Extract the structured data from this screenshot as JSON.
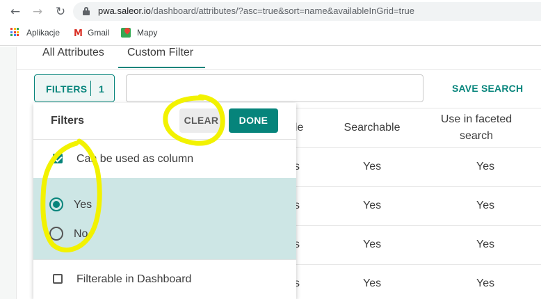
{
  "browser": {
    "url_domain": "pwa.saleor.io",
    "url_path": "/dashboard/attributes/?asc=true&sort=name&availableInGrid=true",
    "bookmarks": [
      {
        "label": "Aplikacje",
        "icon": "apps-grid-icon"
      },
      {
        "label": "Gmail",
        "icon": "gmail-icon"
      },
      {
        "label": "Mapy",
        "icon": "maps-icon"
      }
    ]
  },
  "tabs": [
    "All Attributes",
    "Custom Filter"
  ],
  "toolbar": {
    "filters_label": "FILTERS",
    "filters_count": "1",
    "search_value": "",
    "save_search_label": "SAVE SEARCH"
  },
  "table": {
    "headers": [
      "ble",
      "Searchable",
      "Use in faceted search"
    ],
    "rows": [
      [
        "s",
        "Yes",
        "Yes"
      ],
      [
        "s",
        "Yes",
        "Yes"
      ],
      [
        "s",
        "Yes",
        "Yes"
      ],
      [
        "s",
        "Yes",
        "Yes"
      ]
    ]
  },
  "filter_popover": {
    "title": "Filters",
    "clear_label": "CLEAR",
    "done_label": "DONE",
    "column_option": {
      "label": "Can be used as column",
      "checked": true
    },
    "radio_options": [
      {
        "label": "Yes",
        "selected": true
      },
      {
        "label": "No",
        "selected": false
      }
    ],
    "dashboard_option": {
      "label": "Filterable in Dashboard",
      "checked": false
    }
  },
  "colors": {
    "accent": "#06847b",
    "highlight": "#cde6e5",
    "annotation": "#f2f200"
  }
}
